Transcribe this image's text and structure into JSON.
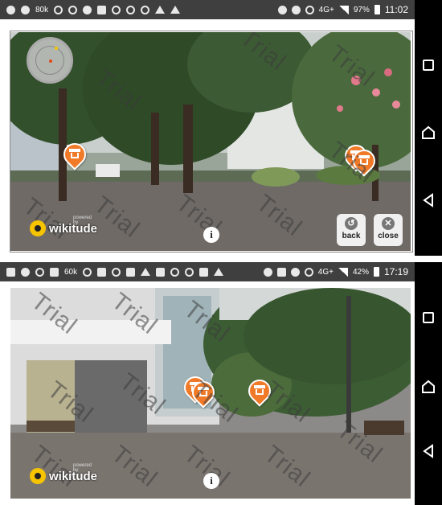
{
  "screen1": {
    "status": {
      "network": "4G+",
      "battery": "97%",
      "time": "11:02",
      "speed": "80k"
    },
    "watermark": "Trial",
    "brand": {
      "name": "wikitude",
      "powered": "powered by"
    },
    "info": "i",
    "buttons": {
      "back": "back",
      "close": "close"
    }
  },
  "screen2": {
    "status": {
      "network": "4G+",
      "battery": "42%",
      "time": "17:19",
      "speed": "60k"
    },
    "watermark": "Trial",
    "brand": {
      "name": "wikitude",
      "powered": "powered by"
    },
    "info": "i"
  },
  "icons": {
    "poi": "building-marker-icon",
    "radar": "radar-icon",
    "back": "back-arrow-icon",
    "close": "close-x-icon"
  },
  "colors": {
    "poi": "#f07a28",
    "statusbar": "#3f3f3f",
    "logo": "#f6c400"
  }
}
